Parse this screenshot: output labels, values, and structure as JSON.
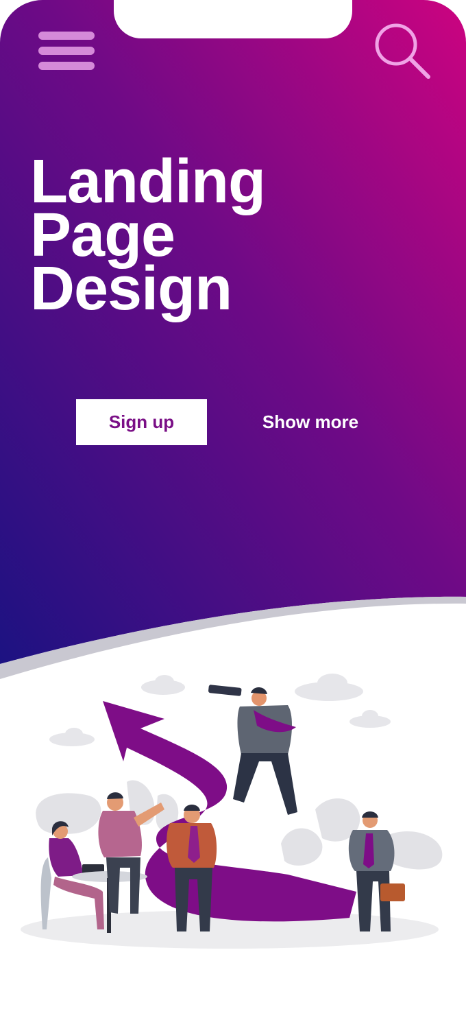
{
  "hero": {
    "title_line1": "Landing",
    "title_line2": "Page",
    "title_line3": "Design",
    "gradient_start": "#20127f",
    "gradient_end": "#c8037e"
  },
  "header": {
    "menu_icon": "hamburger-icon",
    "search_icon": "search-icon",
    "icon_color": "#d58ad9"
  },
  "actions": {
    "signup_label": "Sign up",
    "more_label": "Show more"
  },
  "colors": {
    "accent": "#7a0f86",
    "curve_shadow": "#c8c8d0"
  }
}
